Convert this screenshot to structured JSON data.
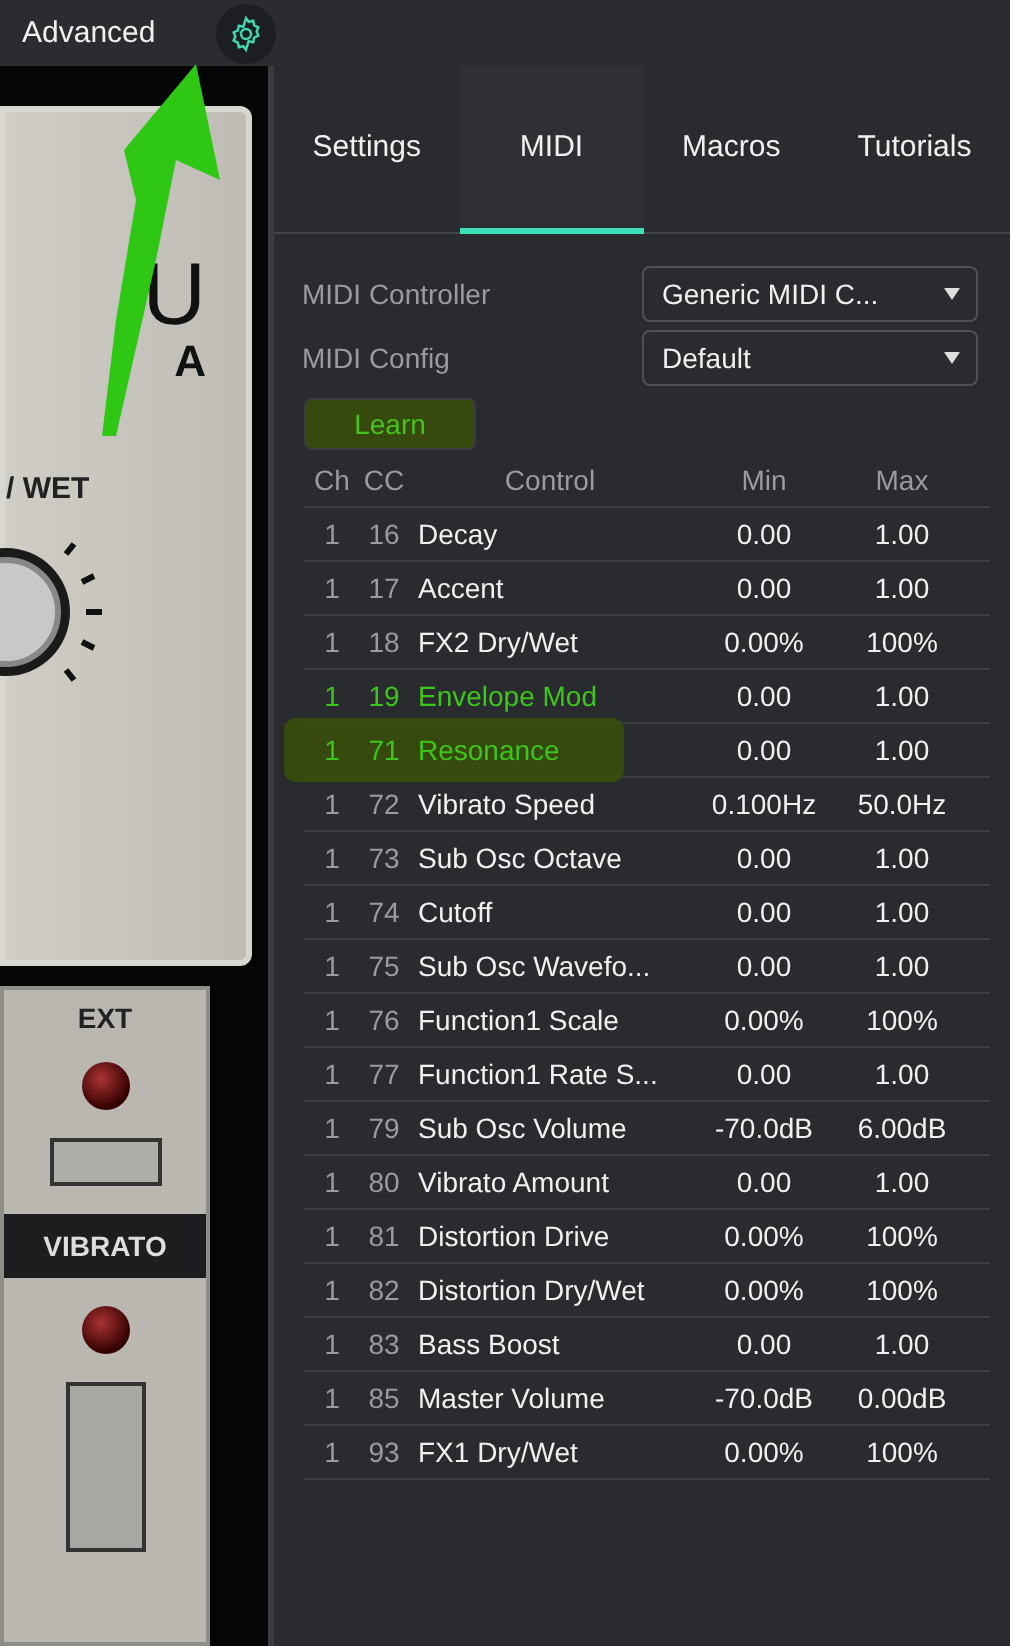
{
  "top_bar": {
    "title": "Advanced"
  },
  "synth_panel": {
    "logo_letters": [
      "U",
      "A"
    ],
    "knob_label": "/ WET",
    "ext_label": "EXT",
    "vibrato_label": "VIBRATO",
    "switches": [
      {
        "on": false
      },
      {
        "on": false
      }
    ]
  },
  "tabs": [
    {
      "label": "Settings",
      "selected": false
    },
    {
      "label": "MIDI",
      "selected": true
    },
    {
      "label": "Macros",
      "selected": false
    },
    {
      "label": "Tutorials",
      "selected": false
    }
  ],
  "fields": [
    {
      "label": "MIDI Controller",
      "value": "Generic MIDI C..."
    },
    {
      "label": "MIDI Config",
      "value": "Default"
    }
  ],
  "learn_button": {
    "label": "Learn",
    "marked": true
  },
  "table": {
    "columns": [
      "Ch",
      "CC",
      "Control",
      "Min",
      "Max"
    ],
    "rows": [
      {
        "ch": "1",
        "cc": "16",
        "control": "Decay",
        "min": "0.00",
        "max": "1.00",
        "accent": false,
        "marked": false
      },
      {
        "ch": "1",
        "cc": "17",
        "control": "Accent",
        "min": "0.00",
        "max": "1.00",
        "accent": false,
        "marked": false
      },
      {
        "ch": "1",
        "cc": "18",
        "control": "FX2 Dry/Wet",
        "min": "0.00%",
        "max": "100%",
        "accent": false,
        "marked": false
      },
      {
        "ch": "1",
        "cc": "19",
        "control": "Envelope Mod",
        "min": "0.00",
        "max": "1.00",
        "accent": true,
        "marked": false
      },
      {
        "ch": "1",
        "cc": "71",
        "control": "Resonance",
        "min": "0.00",
        "max": "1.00",
        "accent": true,
        "marked": true
      },
      {
        "ch": "1",
        "cc": "72",
        "control": "Vibrato Speed",
        "min": "0.100Hz",
        "max": "50.0Hz",
        "accent": false,
        "marked": false
      },
      {
        "ch": "1",
        "cc": "73",
        "control": "Sub Osc Octave",
        "min": "0.00",
        "max": "1.00",
        "accent": false,
        "marked": false
      },
      {
        "ch": "1",
        "cc": "74",
        "control": "Cutoff",
        "min": "0.00",
        "max": "1.00",
        "accent": false,
        "marked": false
      },
      {
        "ch": "1",
        "cc": "75",
        "control": "Sub Osc Wavefo...",
        "min": "0.00",
        "max": "1.00",
        "accent": false,
        "marked": false
      },
      {
        "ch": "1",
        "cc": "76",
        "control": "Function1 Scale",
        "min": "0.00%",
        "max": "100%",
        "accent": false,
        "marked": false
      },
      {
        "ch": "1",
        "cc": "77",
        "control": "Function1 Rate S...",
        "min": "0.00",
        "max": "1.00",
        "accent": false,
        "marked": false
      },
      {
        "ch": "1",
        "cc": "79",
        "control": "Sub Osc Volume",
        "min": "-70.0dB",
        "max": "6.00dB",
        "accent": false,
        "marked": false
      },
      {
        "ch": "1",
        "cc": "80",
        "control": "Vibrato Amount",
        "min": "0.00",
        "max": "1.00",
        "accent": false,
        "marked": false
      },
      {
        "ch": "1",
        "cc": "81",
        "control": "Distortion Drive",
        "min": "0.00%",
        "max": "100%",
        "accent": false,
        "marked": false
      },
      {
        "ch": "1",
        "cc": "82",
        "control": "Distortion Dry/Wet",
        "min": "0.00%",
        "max": "100%",
        "accent": false,
        "marked": false
      },
      {
        "ch": "1",
        "cc": "83",
        "control": "Bass Boost",
        "min": "0.00",
        "max": "1.00",
        "accent": false,
        "marked": false
      },
      {
        "ch": "1",
        "cc": "85",
        "control": "Master Volume",
        "min": "-70.0dB",
        "max": "0.00dB",
        "accent": false,
        "marked": false
      },
      {
        "ch": "1",
        "cc": "93",
        "control": "FX1 Dry/Wet",
        "min": "0.00%",
        "max": "100%",
        "accent": false,
        "marked": false
      }
    ]
  }
}
